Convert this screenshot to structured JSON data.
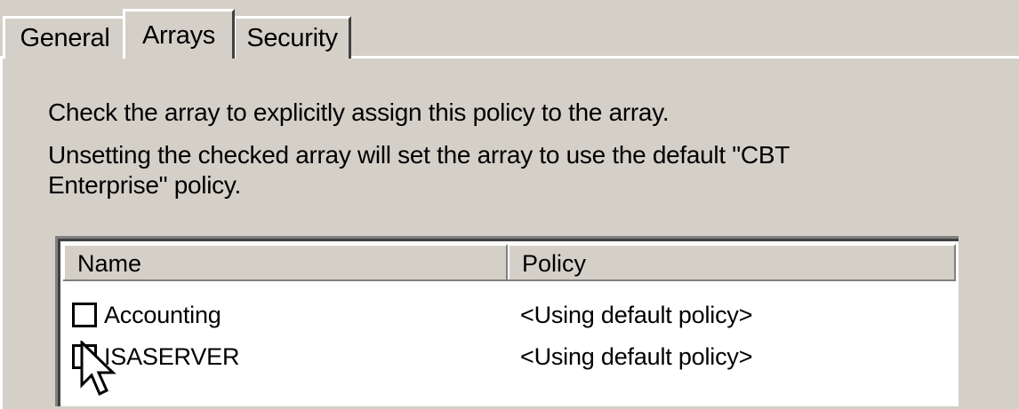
{
  "tabs": [
    {
      "label": "General"
    },
    {
      "label": "Arrays"
    },
    {
      "label": "Security"
    }
  ],
  "description": {
    "line1": "Check the array to explicitly assign this policy to the array.",
    "line2": "Unsetting the checked array will set the array to use the default \"CBT Enterprise\" policy."
  },
  "list": {
    "columns": {
      "name": "Name",
      "policy": "Policy"
    },
    "rows": [
      {
        "name": "Accounting",
        "policy": "<Using default policy>",
        "checked": false
      },
      {
        "name": "ISASERVER",
        "policy": "<Using default policy>",
        "checked": false
      }
    ]
  },
  "icons": {
    "cursor": "mouse-pointer-icon"
  },
  "colors": {
    "face": "#d4d0c8",
    "highlight": "#ffffff",
    "shadow": "#808080",
    "dark_shadow": "#404040"
  }
}
